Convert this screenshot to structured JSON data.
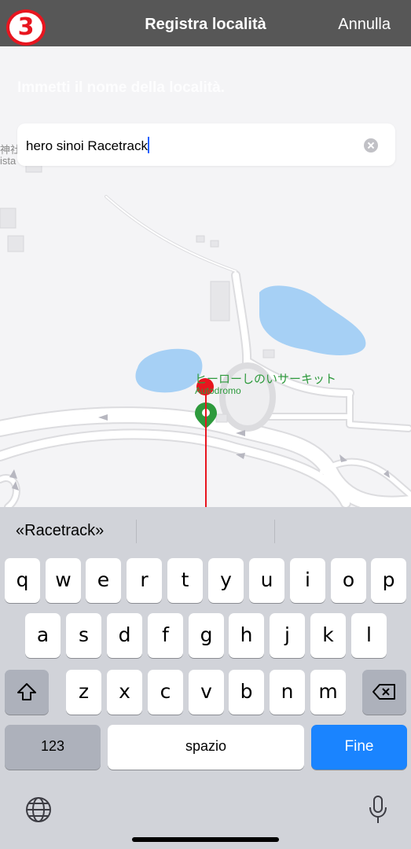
{
  "nav": {
    "step_number": "3",
    "title": "Registra località",
    "cancel_label": "Annulla"
  },
  "prompt": "Immetti il nome della località.",
  "search": {
    "value": "hero sinoi Racetrack"
  },
  "map": {
    "place_name": "ヒーローしのいサーキット",
    "place_category": "Autodromo",
    "edge_label_top": "神社",
    "edge_label_bottom": "ista",
    "colors": {
      "water": "#a6d0f5",
      "road": "#ffffff",
      "road_edge": "#dcdcdf",
      "pin_green": "#2e9a3d",
      "marker_red": "#e8151f"
    }
  },
  "keyboard": {
    "suggestions": [
      "«Racetrack»",
      "",
      ""
    ],
    "row1": [
      "q",
      "w",
      "e",
      "r",
      "t",
      "y",
      "u",
      "i",
      "o",
      "p"
    ],
    "row2": [
      "a",
      "s",
      "d",
      "f",
      "g",
      "h",
      "j",
      "k",
      "l"
    ],
    "row3": [
      "z",
      "x",
      "c",
      "v",
      "b",
      "n",
      "m"
    ],
    "numbers_label": "123",
    "space_label": "spazio",
    "done_label": "Fine",
    "icons": [
      "shift-icon",
      "backspace-icon",
      "globe-icon",
      "microphone-icon"
    ]
  }
}
